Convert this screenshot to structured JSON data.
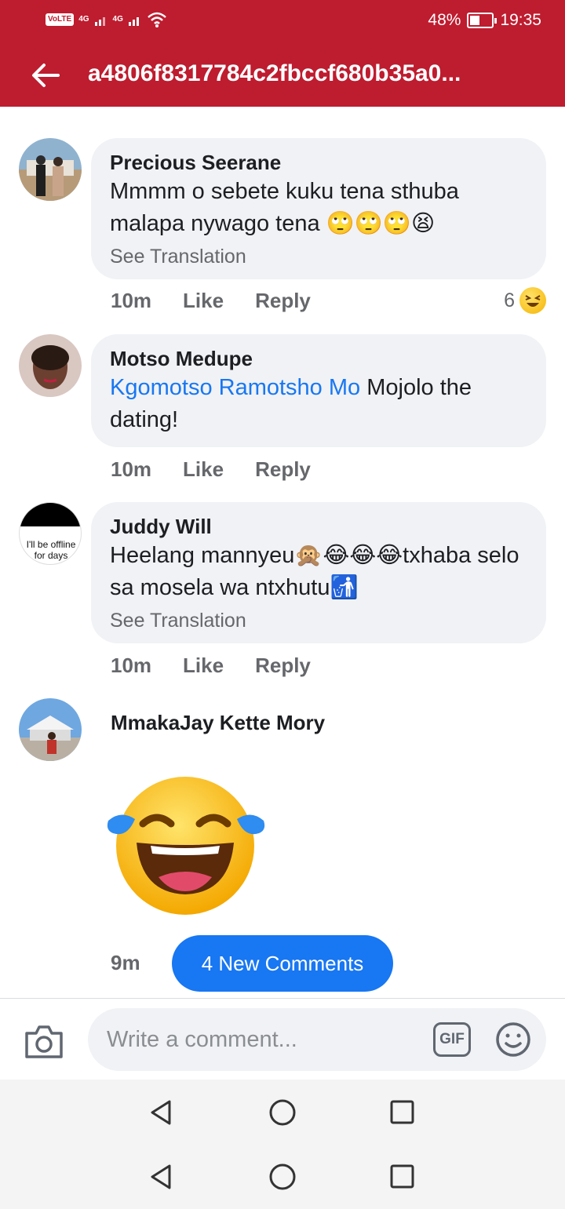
{
  "status_bar": {
    "volte": "VoLTE",
    "network1": "4G",
    "network2": "4G",
    "battery": "48%",
    "time": "19:35"
  },
  "app_bar": {
    "title": "a4806f8317784c2fbccf680b35a0..."
  },
  "comments": [
    {
      "author": "Precious Seerane",
      "text": "Mmmm o sebete kuku tena sthuba malapa nywago tena 🙄🙄🙄😫",
      "see_translation": "See Translation",
      "time": "10m",
      "like": "Like",
      "reply": "Reply",
      "reaction_count": "6",
      "reaction_icon": "laughing-squint-emoji"
    },
    {
      "author": "Motso Medupe",
      "mention": "Kgomotso Ramotsho Mo",
      "text": "Mojolo the dating!",
      "time": "10m",
      "like": "Like",
      "reply": "Reply"
    },
    {
      "author": "Juddy Will",
      "avatar_text": "I'll be offline for days",
      "text": "Heelang mannyeu🙊😂😂😂txhaba selo sa mosela wa ntxhutu🚮",
      "see_translation": "See Translation",
      "time": "10m",
      "like": "Like",
      "reply": "Reply"
    },
    {
      "author": "MmakaJay Kette Mory",
      "sticker": "tears-of-joy-emoji",
      "time": "9m"
    }
  ],
  "new_comments_button": "4 New Comments",
  "composer": {
    "placeholder": "Write a comment...",
    "gif_label": "GIF"
  },
  "colors": {
    "app_bar": "#be1c2f",
    "accent_blue": "#1877f2",
    "bubble": "#f0f2f5",
    "secondary_text": "#65676b"
  }
}
